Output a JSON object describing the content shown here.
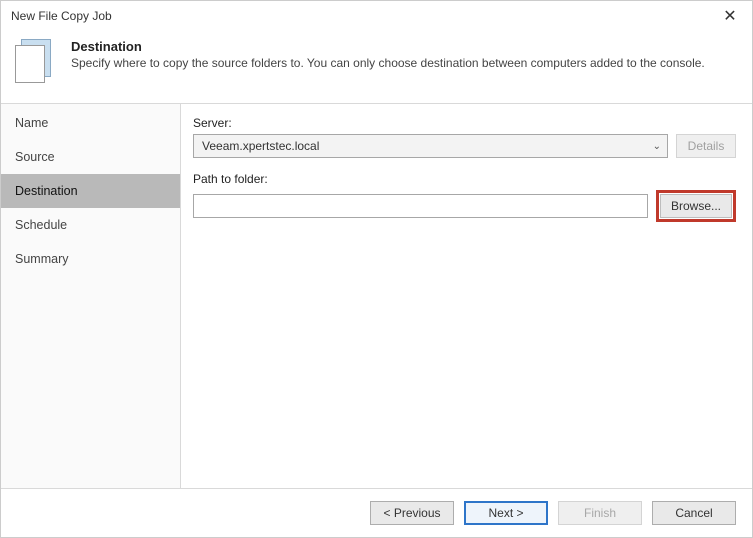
{
  "window": {
    "title": "New File Copy Job"
  },
  "header": {
    "title": "Destination",
    "description": "Specify where to copy the source folders to. You can only choose destination between computers added to the console."
  },
  "sidebar": {
    "steps": [
      {
        "label": "Name"
      },
      {
        "label": "Source"
      },
      {
        "label": "Destination"
      },
      {
        "label": "Schedule"
      },
      {
        "label": "Summary"
      }
    ],
    "active_index": 2
  },
  "content": {
    "server_label": "Server:",
    "server_value": "Veeam.xpertstec.local",
    "details_button": "Details",
    "path_label": "Path to folder:",
    "path_value": "",
    "browse_button": "Browse..."
  },
  "footer": {
    "previous": "< Previous",
    "next": "Next >",
    "finish": "Finish",
    "cancel": "Cancel"
  }
}
